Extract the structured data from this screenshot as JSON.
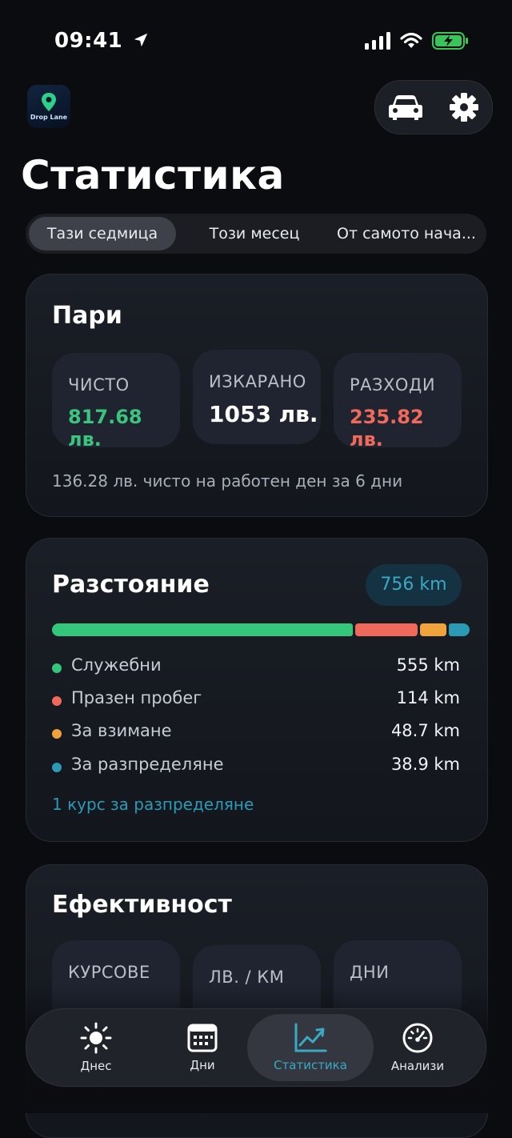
{
  "status_bar": {
    "time": "09:41"
  },
  "header": {
    "app_logo_text": "Drop Lane",
    "title": "Статистика"
  },
  "segments": {
    "items": [
      "Тази седмица",
      "Този месец",
      "От самото нача..."
    ],
    "selected": "Тази седмица"
  },
  "money": {
    "title": "Пари",
    "tiles": [
      {
        "label": "ЧИСТО",
        "value": "817.68 лв.",
        "color": "#3ac47d"
      },
      {
        "label": "ИЗКАРАНО",
        "value": "1053 лв.",
        "color": "#ffffff"
      },
      {
        "label": "РАЗХОДИ",
        "value": "235.82 лв.",
        "color": "#ef6a5b"
      }
    ],
    "note": "136.28 лв. чисто на работен ден за 6 дни"
  },
  "distance": {
    "title": "Разстояние",
    "total": "756 km",
    "breakdown": [
      {
        "label": "Служебни",
        "value": "555 km",
        "km": 555,
        "color": "#34c77b"
      },
      {
        "label": "Празен пробег",
        "value": "114 km",
        "km": 114,
        "color": "#ef6a5b"
      },
      {
        "label": "За взимане",
        "value": "48.7 km",
        "km": 48.7,
        "color": "#f0a33a"
      },
      {
        "label": "За разпределяне",
        "value": "38.9 km",
        "km": 38.9,
        "color": "#2a9ab5"
      }
    ],
    "link": "1 курс за разпределяне"
  },
  "efficiency": {
    "title": "Ефективност",
    "tiles": [
      {
        "label": "КУРСОВЕ"
      },
      {
        "label": "ЛВ. / КМ"
      },
      {
        "label": "ДНИ"
      }
    ]
  },
  "tabbar": {
    "tabs": [
      {
        "label": "Днес",
        "icon": "sun-icon"
      },
      {
        "label": "Дни",
        "icon": "calendar-icon"
      },
      {
        "label": "Статистика",
        "icon": "chart-icon"
      },
      {
        "label": "Анализи",
        "icon": "gauge-icon"
      }
    ],
    "selected": "Статистика"
  }
}
